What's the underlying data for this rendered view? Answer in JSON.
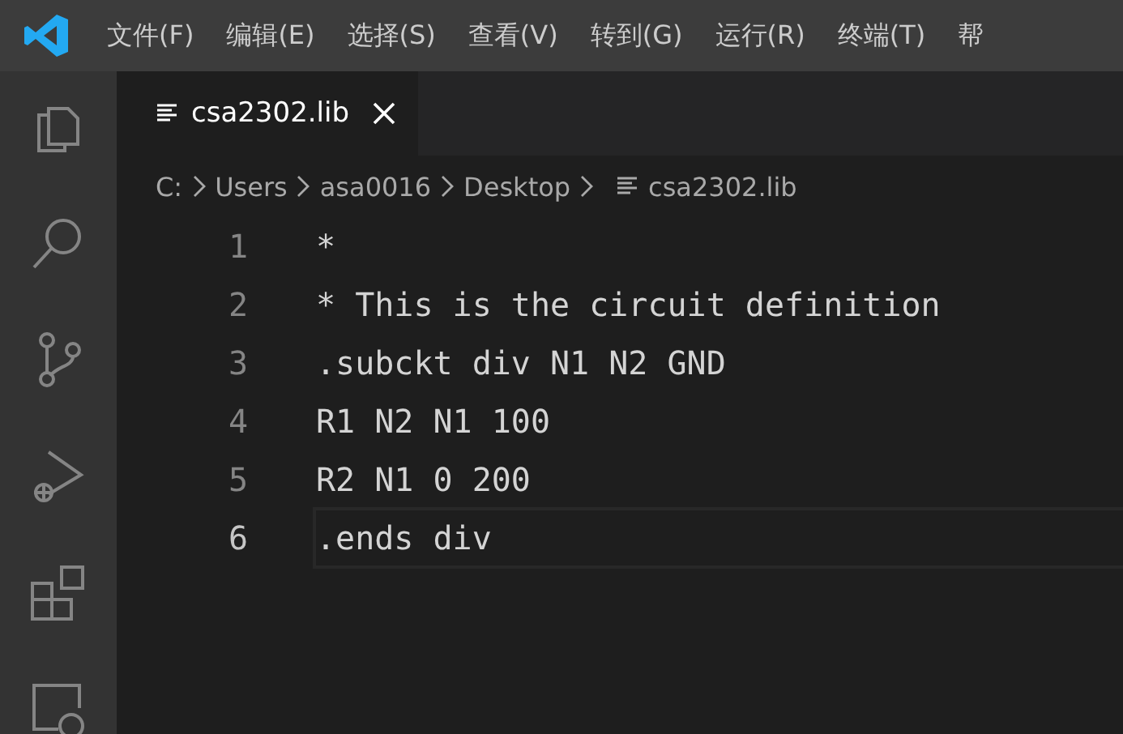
{
  "menu": [
    "文件(F)",
    "编辑(E)",
    "选择(S)",
    "查看(V)",
    "转到(G)",
    "运行(R)",
    "终端(T)",
    "帮"
  ],
  "activity_bar": [
    {
      "kind": "files",
      "selected": false
    },
    {
      "kind": "search",
      "selected": false
    },
    {
      "kind": "source-control",
      "selected": false
    },
    {
      "kind": "run-debug",
      "selected": false
    },
    {
      "kind": "extensions",
      "selected": false
    },
    {
      "kind": "remote",
      "selected": false
    }
  ],
  "tabs": [
    {
      "label": "csa2302.lib",
      "selected": true
    }
  ],
  "breadcrumb": [
    "C:",
    "Users",
    "asa0016",
    "Desktop",
    "csa2302.lib"
  ],
  "lines": [
    {
      "number": "1",
      "code": "*",
      "current": false
    },
    {
      "number": "2",
      "code": "* This is the circuit definition",
      "current": false
    },
    {
      "number": "3",
      "code": ".subckt div N1 N2 GND",
      "current": false
    },
    {
      "number": "4",
      "code": "R1 N2 N1 100",
      "current": false
    },
    {
      "number": "5",
      "code": "R2 N1 0 200",
      "current": false
    },
    {
      "number": "6",
      "code": ".ends div",
      "current": true
    }
  ]
}
